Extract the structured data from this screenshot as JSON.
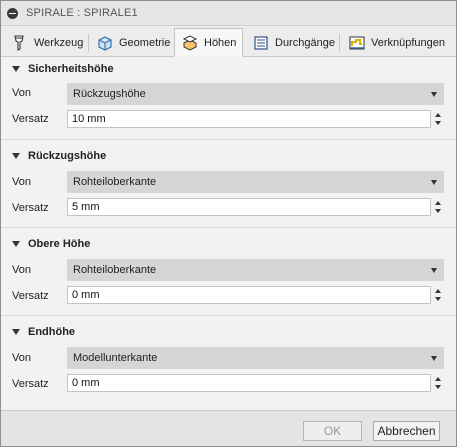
{
  "window": {
    "title": "SPIRALE : SPIRALE1"
  },
  "tabs": [
    {
      "label": "Werkzeug",
      "icon": "tool-icon",
      "active": false
    },
    {
      "label": "Geometrie",
      "icon": "geometry-icon",
      "active": false
    },
    {
      "label": "Höhen",
      "icon": "heights-icon",
      "active": true
    },
    {
      "label": "Durchgänge",
      "icon": "passes-icon",
      "active": false
    },
    {
      "label": "Verknüpfungen",
      "icon": "linking-icon",
      "active": false
    }
  ],
  "sections": [
    {
      "title": "Sicherheitshöhe",
      "from_label": "Von",
      "from_value": "Rückzugshöhe",
      "offset_label": "Versatz",
      "offset_value": "10 mm"
    },
    {
      "title": "Rückzugshöhe",
      "from_label": "Von",
      "from_value": "Rohteiloberkante",
      "offset_label": "Versatz",
      "offset_value": "5 mm"
    },
    {
      "title": "Obere Höhe",
      "from_label": "Von",
      "from_value": "Rohteiloberkante",
      "offset_label": "Versatz",
      "offset_value": "0 mm"
    },
    {
      "title": "Endhöhe",
      "from_label": "Von",
      "from_value": "Modellunterkante",
      "offset_label": "Versatz",
      "offset_value": "0 mm"
    }
  ],
  "footer": {
    "ok_label": "OK",
    "cancel_label": "Abbrechen",
    "ok_enabled": false
  },
  "colors": {
    "select_bg": "#d5d5d5",
    "panel_bg": "#f2f2f2",
    "tab_active_bg": "#f7f7f7"
  }
}
